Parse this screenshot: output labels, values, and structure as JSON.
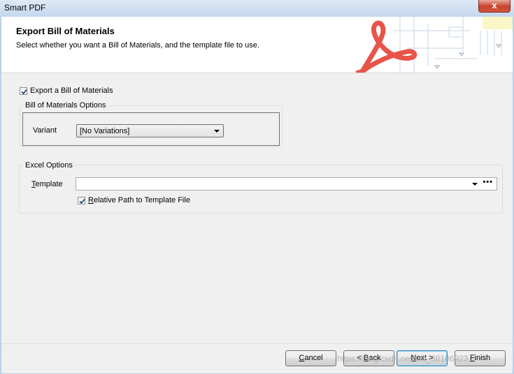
{
  "window": {
    "title": "Smart PDF",
    "close_glyph": "x"
  },
  "header": {
    "title": "Export Bill of Materials",
    "subtitle": "Select whether you want a Bill of Materials, and the template file to use.",
    "logo_icon": "acrobat-logo-icon"
  },
  "export_bom": {
    "label": "Export a Bill of Materials",
    "checked": true
  },
  "bom_options": {
    "title": "Bill of Materials Options",
    "variant_label": "Variant",
    "variant_value": "[No Variations]"
  },
  "excel_options": {
    "title": "Excel Options",
    "template_label_first": "T",
    "template_label_rest": "emplate",
    "template_value": "",
    "browse_glyph": "•••",
    "relative_path_first": "R",
    "relative_path_rest": "elative Path to Template File",
    "relative_path_checked": true
  },
  "footer": {
    "cancel_first": "C",
    "cancel_rest": "ancel",
    "back_pre": "< ",
    "back_first": "B",
    "back_rest": "ack",
    "next_first": "N",
    "next_rest": "ext >",
    "finish_first": "F",
    "finish_rest": "inish",
    "watermark": "https://blog.csdn.net/m0_38106923"
  },
  "colors": {
    "accent": "#3c7fb1",
    "logo": "#e8544a",
    "window_frame": "#b9d1ea"
  }
}
